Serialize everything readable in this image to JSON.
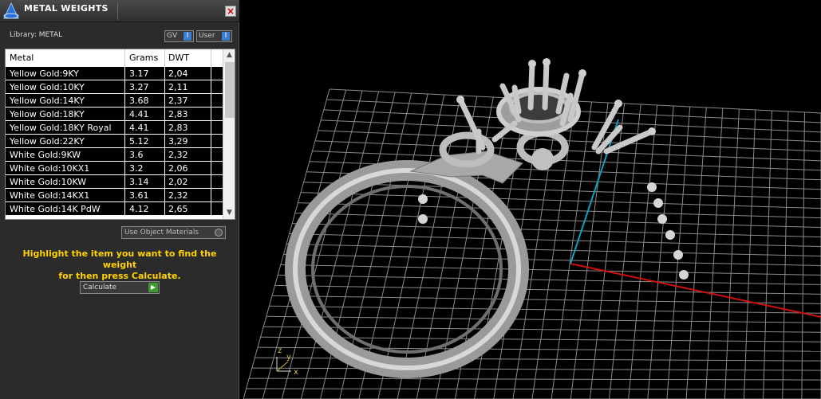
{
  "panel": {
    "title": "METAL WEIGHTS",
    "close_label": "×",
    "library_label": "Library: METAL",
    "gv_toggle_label": "GV",
    "user_toggle_label": "User",
    "toggle_indicator": "I",
    "table": {
      "columns": [
        "Metal",
        "Grams",
        "DWT"
      ],
      "rows": [
        [
          "Yellow Gold:9KY",
          "3.17",
          "2,04"
        ],
        [
          "Yellow Gold:10KY",
          "3.27",
          "2,11"
        ],
        [
          "Yellow Gold:14KY",
          "3.68",
          "2,37"
        ],
        [
          "Yellow Gold:18KY",
          "4.41",
          "2,83"
        ],
        [
          "Yellow Gold:18KY Royal",
          "4.41",
          "2,83"
        ],
        [
          "Yellow Gold:22KY",
          "5.12",
          "3,29"
        ],
        [
          "White Gold:9KW",
          "3.6",
          "2,32"
        ],
        [
          "White Gold:10KX1",
          "3.2",
          "2,06"
        ],
        [
          "White Gold:10KW",
          "3.14",
          "2,02"
        ],
        [
          "White Gold:14KX1",
          "3.61",
          "2,32"
        ],
        [
          "White Gold:14K PdW",
          "4.12",
          "2,65"
        ]
      ]
    },
    "use_object_materials_label": "Use Object Materials",
    "instruction_line1": "Highlight the item you want to find the weight",
    "instruction_line2": "for then press Calculate.",
    "calculate_label": "Calculate",
    "calculate_arrow": "▶"
  },
  "viewport": {
    "axis_labels": {
      "z": "z",
      "y": "y",
      "x": "x"
    },
    "colors": {
      "grid": "#8a8a8a",
      "x_axis": "#d01010",
      "y_axis": "#10a0c0",
      "ring": "#b0b0b0"
    }
  }
}
